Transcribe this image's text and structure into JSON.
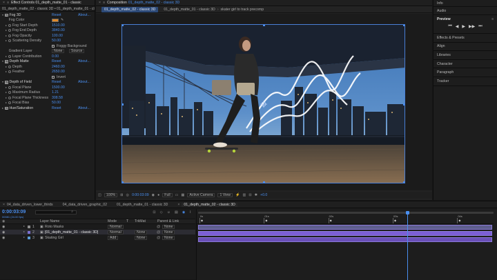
{
  "effect_controls": {
    "tab_label": "Effect Controls 01_depth_matte_01 - classic",
    "breadcrumb": "01_depth_matte_02 - classic 3D • 01_depth_matte_01 - classic",
    "rows": [
      {
        "indent": 0,
        "twirl": "down",
        "fx": true,
        "label": "Fog 3D",
        "value": "Reset",
        "about": "About...",
        "blue": true
      },
      {
        "indent": 1,
        "twirl": "none",
        "sw": false,
        "label": "Fog Color",
        "swatch": "#e0892a",
        "dropper": true
      },
      {
        "indent": 1,
        "twirl": "right",
        "sw": true,
        "label": "Fog Start Depth",
        "value": "1510.00",
        "blue": true
      },
      {
        "indent": 1,
        "twirl": "right",
        "sw": true,
        "label": "Fog End Depth",
        "value": "3840.00",
        "blue": true
      },
      {
        "indent": 1,
        "twirl": "right",
        "sw": true,
        "label": "Fog Opacity",
        "value": "100.00",
        "blue": true
      },
      {
        "indent": 1,
        "twirl": "right",
        "sw": true,
        "label": "Scattering Density",
        "value": "50.00",
        "blue": true
      },
      {
        "indent": 1,
        "twirl": "none",
        "sw": false,
        "label": "",
        "check": "Foggy Background"
      },
      {
        "indent": 1,
        "twirl": "none",
        "sw": false,
        "label": "Gradient Layer",
        "dd1": "None",
        "dd2": "Source"
      },
      {
        "indent": 1,
        "twirl": "right",
        "sw": true,
        "label": "Layer Contribution",
        "value": "0.00",
        "blue": true
      },
      {
        "indent": 0,
        "twirl": "down",
        "fx": true,
        "label": "Depth Matte",
        "value": "Reset",
        "about": "About...",
        "blue": true
      },
      {
        "indent": 1,
        "twirl": "right",
        "sw": true,
        "label": "Depth",
        "value": "2460.00",
        "blue": true
      },
      {
        "indent": 1,
        "twirl": "right",
        "sw": true,
        "label": "Feather",
        "value": "2650.00",
        "blue": true
      },
      {
        "indent": 1,
        "twirl": "none",
        "sw": false,
        "label": "",
        "check": "Invert"
      },
      {
        "indent": 0,
        "twirl": "down",
        "fx": true,
        "label": "Depth of Field",
        "value": "Reset",
        "about": "About...",
        "blue": true
      },
      {
        "indent": 1,
        "twirl": "right",
        "sw": true,
        "label": "Focal Plane",
        "value": "1500.00",
        "blue": true
      },
      {
        "indent": 1,
        "twirl": "right",
        "sw": true,
        "label": "Maximum Radius",
        "value": "1.21",
        "blue": true
      },
      {
        "indent": 1,
        "twirl": "right",
        "sw": true,
        "label": "Focal Plane Thickness",
        "value": "308.58",
        "blue": true
      },
      {
        "indent": 1,
        "twirl": "right",
        "sw": true,
        "label": "Focal Bias",
        "value": "50.00",
        "blue": true
      },
      {
        "indent": 0,
        "twirl": "right",
        "fx": true,
        "label": "Hue/Saturation",
        "value": "Reset",
        "about": "About...",
        "blue": true
      }
    ]
  },
  "composition": {
    "tab_label": "Composition",
    "tab_name": "01_depth_matte_02 - classic 3D",
    "subtabs": [
      "01_depth_matte_02 - classic 3D",
      "01_depth_matte_01 - classic 3D"
    ],
    "breadcrumb_extra": "skater girl to track precomp",
    "footer": {
      "zoom": "100%",
      "timecode": "0:00:03:09",
      "resolution": "Full",
      "camera": "Active Camera",
      "views": "1 View",
      "exposure": "+0.0"
    }
  },
  "right_panel": {
    "info": "Info",
    "audio": "Audio",
    "preview": "Preview",
    "items": [
      "Effects & Presets",
      "Align",
      "Libraries",
      "Character",
      "Paragraph",
      "Tracker"
    ]
  },
  "timeline": {
    "tabs": [
      "04_data_driven_lower_thirds",
      "04_data_driven_graphic_02",
      "01_depth_matte_01 - classic 3D",
      "01_depth_matte_02 - classic 3D"
    ],
    "timecode": "0:00:03:09",
    "fps": "00081 (24.00 fps)",
    "columns": {
      "layer_name": "Layer Name",
      "mode": "Mode",
      "t": "T",
      "trkmat": "TrkMat",
      "parent": "Parent & Link"
    },
    "layers": [
      {
        "num": "1",
        "name": "Roto Masks",
        "mode": "Normal",
        "trkmat": "",
        "parent": "None",
        "color": "#8c8c8c"
      },
      {
        "num": "2",
        "name": "[01_depth_matte_01 - classic 3D]",
        "mode": "Normal",
        "trkmat": "None",
        "parent": "None",
        "color": "#7a6fd0",
        "selected": true
      },
      {
        "num": "3",
        "name": "Skating Girl",
        "mode": "Add",
        "trkmat": "None",
        "parent": "None",
        "color": "#5a9bd5"
      }
    ],
    "ruler": [
      "0s",
      "01s",
      "02s",
      "03s",
      "04s"
    ],
    "playhead_fraction": 0.71
  },
  "colors": {
    "accent": "#4a8ff0",
    "selection": "#8b6fe0",
    "bar1": "#5e5e8e",
    "bar2": "#7c5fd6",
    "bar3": "#6a4fb8"
  }
}
